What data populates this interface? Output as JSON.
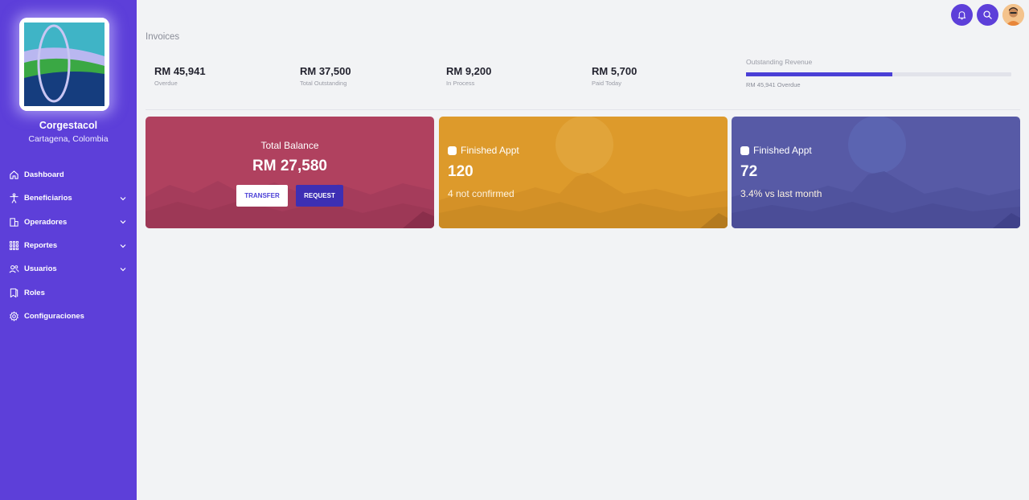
{
  "sidebar": {
    "org_name": "Corgestacol",
    "org_location": "Cartagena, Colombia",
    "items": [
      {
        "label": "Dashboard",
        "icon": "home-icon",
        "expandable": false
      },
      {
        "label": "Beneficiarios",
        "icon": "person-accessibility-icon",
        "expandable": true
      },
      {
        "label": "Operadores",
        "icon": "building-icon",
        "expandable": true
      },
      {
        "label": "Reportes",
        "icon": "grid-icon",
        "expandable": true
      },
      {
        "label": "Usuarios",
        "icon": "users-icon",
        "expandable": true
      },
      {
        "label": "Roles",
        "icon": "bookmark-icon",
        "expandable": false
      },
      {
        "label": "Configuraciones",
        "icon": "gear-icon",
        "expandable": false
      }
    ]
  },
  "header": {
    "title": "Invoices",
    "icons": [
      "bell-icon",
      "search-icon",
      "avatar"
    ]
  },
  "stats": [
    {
      "value": "RM 45,941",
      "label": "Overdue"
    },
    {
      "value": "RM 37,500",
      "label": "Total Outstanding"
    },
    {
      "value": "RM 9,200",
      "label": "In Process"
    },
    {
      "value": "RM 5,700",
      "label": "Paid Today"
    }
  ],
  "revenue": {
    "title": "Outstanding Revenue",
    "subtitle": "RM 45,941 Overdue",
    "progress": 0.55
  },
  "cards": {
    "balance": {
      "title": "Total Balance",
      "value": "RM 27,580",
      "transfer_label": "TRANSFER",
      "request_label": "REQUEST"
    },
    "appt1": {
      "title": "Finished Appt",
      "value": "120",
      "subtitle": "4 not confirmed"
    },
    "appt2": {
      "title": "Finished Appt",
      "value": "72",
      "subtitle": "3.4% vs last month"
    }
  },
  "colors": {
    "sidebar": "#5d3fd9",
    "card_balance": "#b0415f",
    "card_orange": "#dd9a2b",
    "card_purple": "#575aa6",
    "accent": "#4a3fd6"
  }
}
